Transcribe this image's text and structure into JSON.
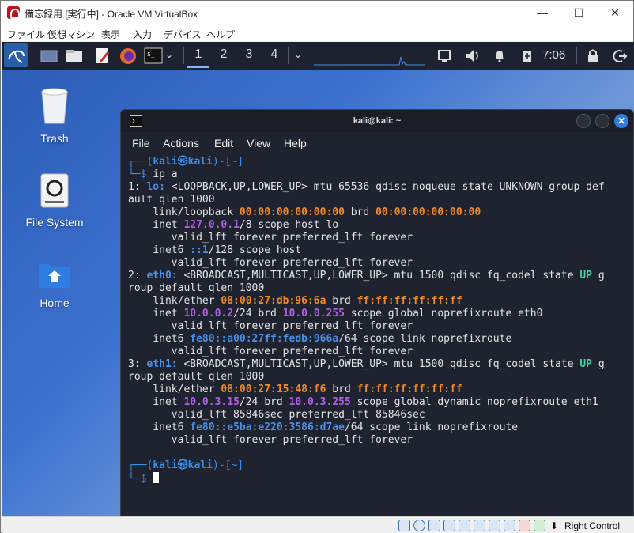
{
  "window": {
    "title": "備忘録用 [実行中] - Oracle VM VirtualBox",
    "controls": [
      "minimize-icon",
      "maximize-icon",
      "close-icon"
    ]
  },
  "menu": [
    "ファイル",
    "仮想マシン",
    "表示",
    "入力",
    "デバイス",
    "ヘルプ"
  ],
  "panel": {
    "workspaces": [
      "1",
      "2",
      "3",
      "4"
    ],
    "clock": "7:06"
  },
  "desktop": {
    "icons": [
      {
        "label": "Trash"
      },
      {
        "label": "File System"
      },
      {
        "label": "Home"
      }
    ]
  },
  "terminal": {
    "title": "kali@kali: ~",
    "menu": [
      "File",
      "Actions",
      "Edit",
      "View",
      "Help"
    ]
  },
  "statusbar": {
    "host_key": "Right Control"
  },
  "colors": {
    "panel": "#1d2230",
    "terminal_bg": "#1f2330",
    "prompt_blue": "#3b8fe6",
    "mac_orange": "#f08a24",
    "ip_magenta": "#b160e6",
    "state_green": "#44d0a0"
  }
}
